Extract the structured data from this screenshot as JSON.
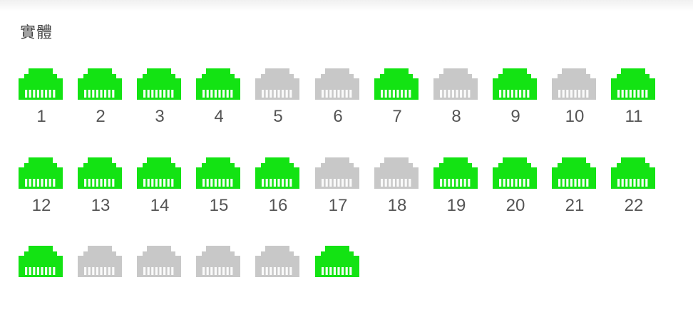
{
  "section": {
    "title": "實體"
  },
  "colors": {
    "link_up": "#13e313",
    "link_down": "#c8c8c8",
    "label": "#555555"
  },
  "ports": [
    {
      "label": "1",
      "status": "up"
    },
    {
      "label": "2",
      "status": "up"
    },
    {
      "label": "3",
      "status": "up"
    },
    {
      "label": "4",
      "status": "up"
    },
    {
      "label": "5",
      "status": "down"
    },
    {
      "label": "6",
      "status": "down"
    },
    {
      "label": "7",
      "status": "up"
    },
    {
      "label": "8",
      "status": "down"
    },
    {
      "label": "9",
      "status": "up"
    },
    {
      "label": "10",
      "status": "down"
    },
    {
      "label": "11",
      "status": "up"
    },
    {
      "label": "12",
      "status": "up"
    },
    {
      "label": "13",
      "status": "up"
    },
    {
      "label": "14",
      "status": "up"
    },
    {
      "label": "15",
      "status": "up"
    },
    {
      "label": "16",
      "status": "up"
    },
    {
      "label": "17",
      "status": "down"
    },
    {
      "label": "18",
      "status": "down"
    },
    {
      "label": "19",
      "status": "up"
    },
    {
      "label": "20",
      "status": "up"
    },
    {
      "label": "21",
      "status": "up"
    },
    {
      "label": "22",
      "status": "up"
    },
    {
      "label": "",
      "status": "up"
    },
    {
      "label": "",
      "status": "down"
    },
    {
      "label": "",
      "status": "down"
    },
    {
      "label": "",
      "status": "down"
    },
    {
      "label": "",
      "status": "down"
    },
    {
      "label": "",
      "status": "up"
    }
  ]
}
